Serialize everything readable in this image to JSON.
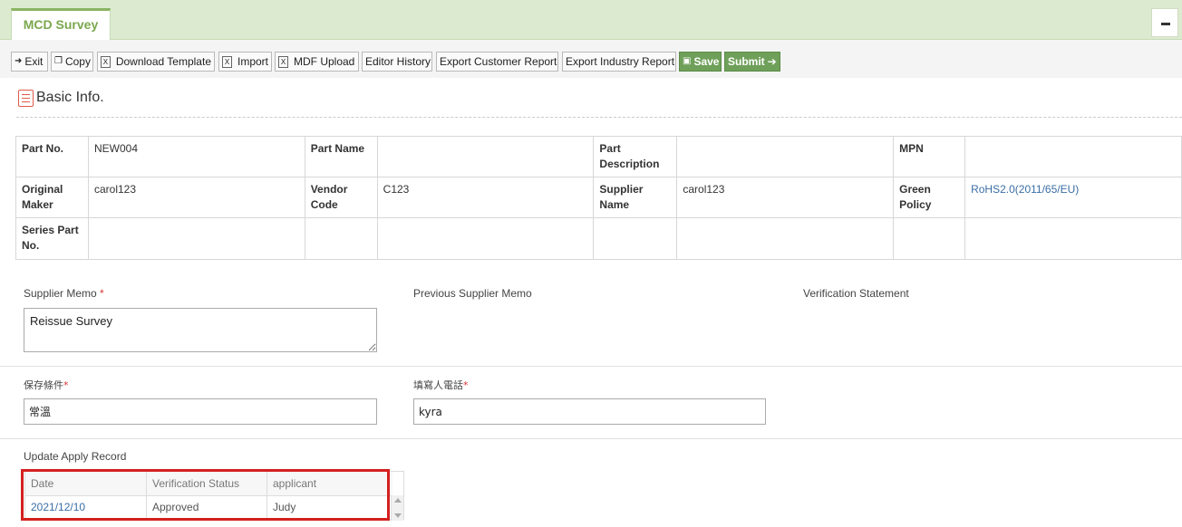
{
  "tab": {
    "label": "MCD Survey"
  },
  "toolbar": {
    "exit": "Exit",
    "copy": "Copy",
    "download_template": "Download Template",
    "import": "Import",
    "mdf_upload": "MDF Upload",
    "editor_history": "Editor History",
    "export_customer_report": "Export Customer Report",
    "export_industry_report": "Export Industry Report",
    "save": "Save",
    "submit": "Submit"
  },
  "section": {
    "title": "Basic Info."
  },
  "basic_info": {
    "part_no_label": "Part No.",
    "part_no": "NEW004",
    "part_name_label": "Part Name",
    "part_name": "",
    "part_description_label": "Part Description",
    "part_description": "",
    "mpn_label": "MPN",
    "mpn": "",
    "original_maker_label": "Original Maker",
    "original_maker": "carol123",
    "vendor_code_label": "Vendor Code",
    "vendor_code": "C123",
    "supplier_name_label": "Supplier Name",
    "supplier_name": "carol123",
    "green_policy_label": "Green Policy",
    "green_policy": "RoHS2.0(2011/65/EU)",
    "series_part_no_label": "Series Part No.",
    "series_part_no": ""
  },
  "memo": {
    "supplier_memo_label": "Supplier Memo",
    "supplier_memo_value": "Reissue Survey",
    "previous_supplier_memo_label": "Previous Supplier Memo",
    "verification_statement_label": "Verification Statement",
    "required_mark": "*"
  },
  "fields": {
    "storage_label": "保存條件",
    "storage_value": "常溫",
    "phone_label": "填寫人電話",
    "phone_value": "kyra"
  },
  "apply_record": {
    "title": "Update Apply Record",
    "columns": [
      "Date",
      "Verification Status",
      "applicant"
    ],
    "rows": [
      {
        "date": "2021/12/10",
        "status": "Approved",
        "applicant": "Judy"
      }
    ]
  }
}
